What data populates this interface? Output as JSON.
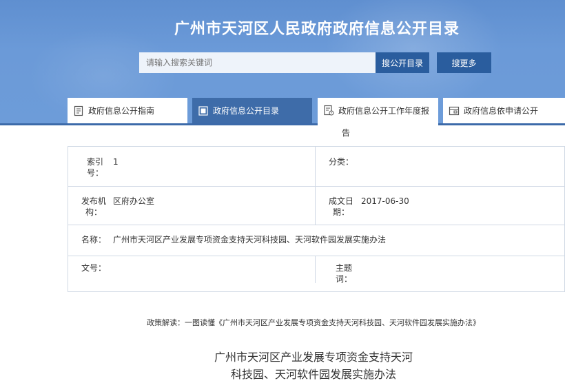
{
  "header": {
    "title": "广州市天河区人民政府政府信息公开目录",
    "search_placeholder": "请输入搜索关键词",
    "search_button": "搜公开目录",
    "more_button": "搜更多"
  },
  "tabs": [
    {
      "label": "政府信息公开指南",
      "icon": "document-icon",
      "active": false
    },
    {
      "label": "政府信息公开目录",
      "icon": "catalog-icon",
      "active": true
    },
    {
      "label": "政府信息公开工作年度报",
      "label_cont": "告",
      "icon": "report-icon",
      "active": false
    },
    {
      "label": "政府信息依申请公开",
      "icon": "application-icon",
      "active": false
    }
  ],
  "info": {
    "index_label_1": "索引",
    "index_label_2": "号：",
    "index_value": "1",
    "category_label": "分类：",
    "category_value": "",
    "publisher_label_1": "发布机",
    "publisher_label_2": "构：",
    "publisher_value": "区府办公室",
    "date_label_1": "成文日",
    "date_label_2": "期：",
    "date_value": "2017-06-30",
    "name_label": "名称：",
    "name_value": "广州市天河区产业发展专项资金支持天河科技园、天河软件园发展实施办法",
    "docno_label": "文号：",
    "docno_value": "",
    "subject_label_1": "主题",
    "subject_label_2": "词："
  },
  "policy_link": "政策解读：一图读懂《广州市天河区产业发展专项资金支持天河科技园、天河软件园发展实施办法》",
  "doc_title_line1": "广州市天河区产业发展专项资金支持天河",
  "doc_title_line2": "科技园、天河软件园发展实施办法",
  "colors": {
    "banner": "#6b9ad8",
    "button": "#2a5d9e",
    "active_tab": "#3e6ca9"
  }
}
